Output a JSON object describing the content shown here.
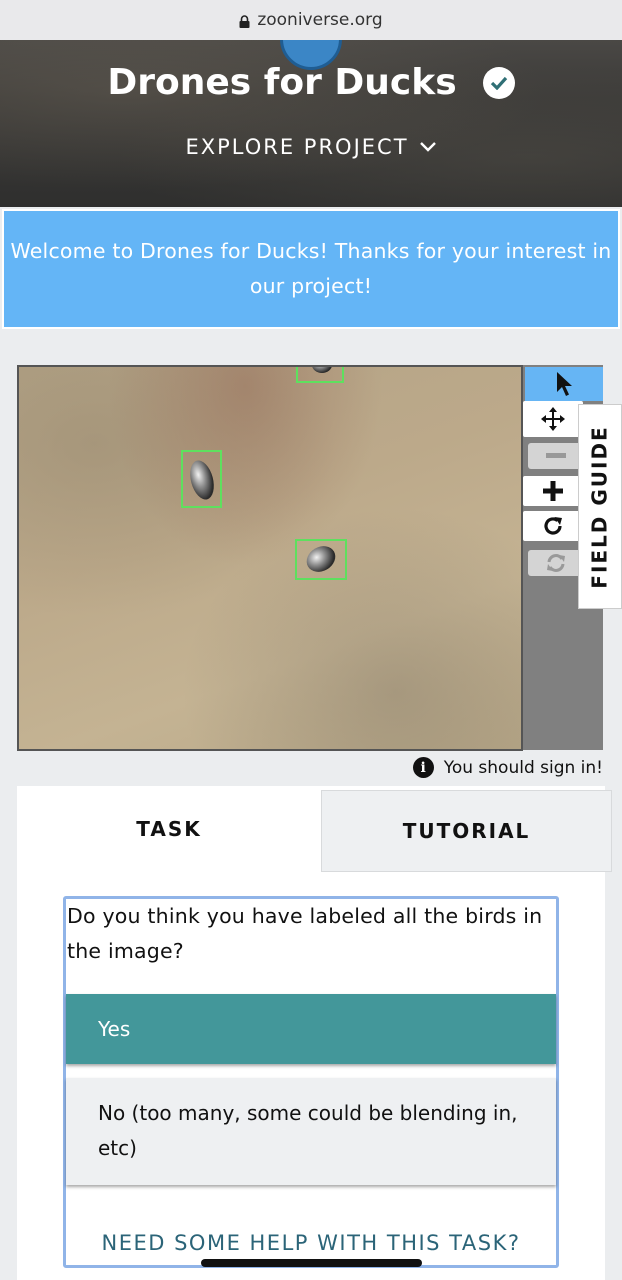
{
  "browser": {
    "url": "zooniverse.org",
    "lock_icon": "lock-icon"
  },
  "header": {
    "project_title": "Drones for Ducks",
    "verified_icon": "check-badge-icon",
    "explore_label": "EXPLORE PROJECT",
    "explore_icon": "chevron-down-icon"
  },
  "welcome": {
    "message": "Welcome to Drones for Ducks! Thanks for your interest in our project!"
  },
  "viewer": {
    "tools": [
      {
        "name": "pointer-icon",
        "active": true
      },
      {
        "name": "move-icon",
        "active": false
      },
      {
        "name": "zoom-out-icon",
        "active": false,
        "disabled": true
      },
      {
        "name": "zoom-in-icon",
        "active": false
      },
      {
        "name": "rotate-icon",
        "active": false
      },
      {
        "name": "reset-icon",
        "active": false,
        "disabled": true
      }
    ],
    "field_guide_label": "FIELD GUIDE"
  },
  "signin_notice": {
    "text": "You should sign in!",
    "icon": "info-icon"
  },
  "tabs": {
    "task": "TASK",
    "tutorial": "TUTORIAL"
  },
  "task": {
    "question": "Do you think you have labeled all the birds in the image?",
    "answers": [
      {
        "label": "Yes",
        "selected": true
      },
      {
        "label": "No (too many, some could be blending in, etc)",
        "selected": false
      }
    ],
    "help_label": "NEED SOME HELP WITH THIS TASK?"
  },
  "colors": {
    "welcome_bg": "#64b5f6",
    "selected_answer": "#43979a",
    "box_stroke": "#5ee05e",
    "active_tool": "#66b5f4"
  }
}
